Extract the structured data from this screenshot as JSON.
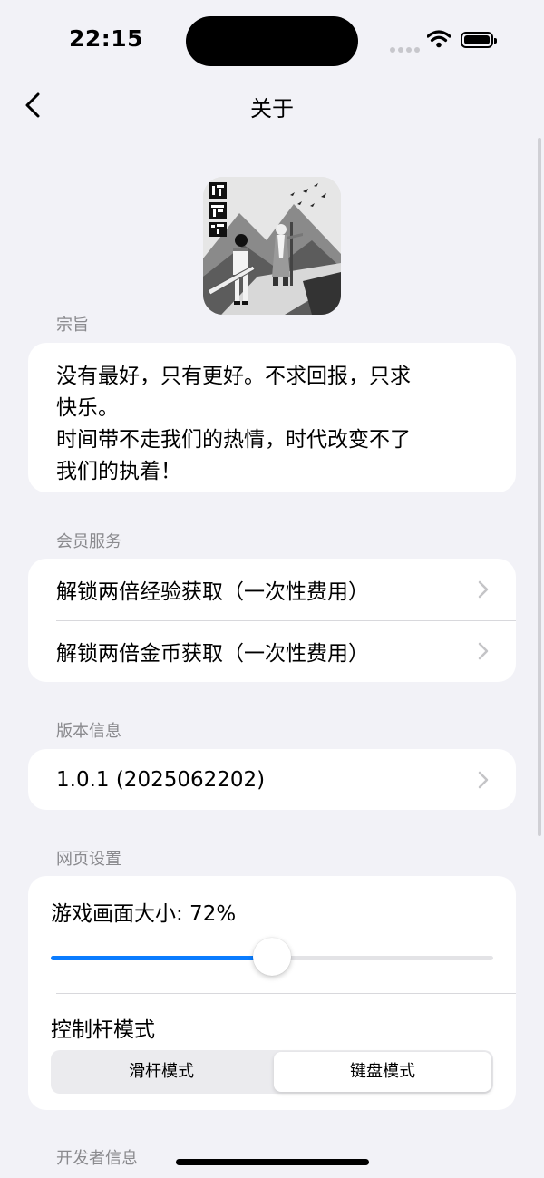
{
  "status": {
    "time": "22:15"
  },
  "nav": {
    "title": "关于"
  },
  "sections": {
    "motto_header": "宗旨",
    "member_header": "会员服务",
    "version_header": "版本信息",
    "web_header": "网页设置",
    "developer_header": "开发者信息"
  },
  "motto": {
    "text": "没有最好，只有更好。不求回报，只求\n快乐。\n时间带不走我们的热情，时代改变不了\n我们的执着！"
  },
  "member": {
    "items": [
      {
        "label": "解锁两倍经验获取（一次性费用）"
      },
      {
        "label": "解锁两倍金币获取（一次性费用）"
      }
    ]
  },
  "version": {
    "value": "1.0.1 (2025062202)"
  },
  "web": {
    "size_label": "游戏画面大小: 72%",
    "size_value": 0.5,
    "joystick_label": "控制杆模式",
    "modes": [
      {
        "label": "滑杆模式",
        "selected": false
      },
      {
        "label": "键盘模式",
        "selected": true
      }
    ]
  },
  "colors": {
    "accent": "#0a7cff",
    "background": "#f2f2f7"
  }
}
